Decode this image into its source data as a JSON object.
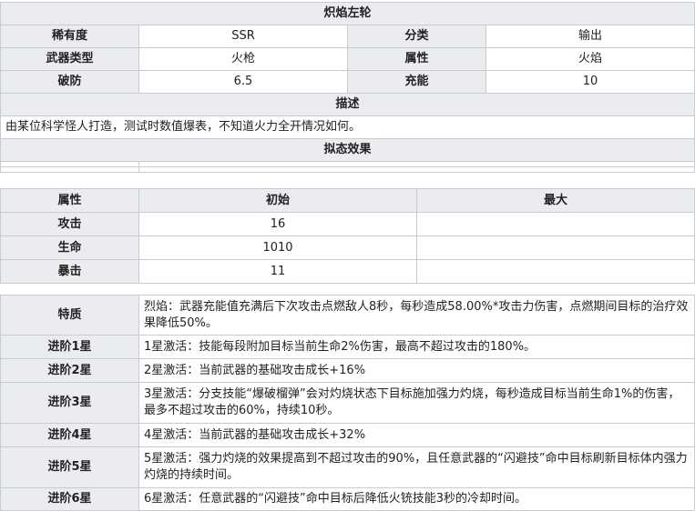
{
  "weapon": {
    "name": "炽焰左轮",
    "rarity_label": "稀有度",
    "rarity_value": "SSR",
    "category_label": "分类",
    "category_value": "输出",
    "type_label": "武器类型",
    "type_value": "火枪",
    "element_label": "属性",
    "element_value": "火焰",
    "armor_break_label": "破防",
    "armor_break_value": "6.5",
    "charge_label": "充能",
    "charge_value": "10",
    "desc_header": "描述",
    "desc_text": "由某位科学怪人打造，测试时数值爆表，不知道火力全开情况如何。",
    "effect_header": "拟态效果"
  },
  "stats": {
    "headers": [
      "属性",
      "初始",
      "最大"
    ],
    "rows": [
      {
        "name": "攻击",
        "initial": "16",
        "max": ""
      },
      {
        "name": "生命",
        "initial": "1010",
        "max": ""
      },
      {
        "name": "暴击",
        "initial": "11",
        "max": ""
      }
    ]
  },
  "traits": [
    {
      "label": "特质",
      "text": "烈焰：武器充能值充满后下次攻击点燃敌人8秒，每秒造成58.00%*攻击力伤害，点燃期间目标的治疗效果降低50%。"
    },
    {
      "label": "进阶1星",
      "text": "1星激活：技能每段附加目标当前生命2%伤害，最高不超过攻击的180%。"
    },
    {
      "label": "进阶2星",
      "text": "2星激活：当前武器的基础攻击成长+16%"
    },
    {
      "label": "进阶3星",
      "text": "3星激活：分支技能“爆破榴弹”会对灼烧状态下目标施加强力灼烧，每秒造成目标当前生命1%的伤害，最多不超过攻击的60%，持续10秒。"
    },
    {
      "label": "进阶4星",
      "text": "4星激活：当前武器的基础攻击成长+32%"
    },
    {
      "label": "进阶5星",
      "text": "5星激活：强力灼烧的效果提高到不超过攻击的90%，且任意武器的“闪避技”命中目标刷新目标体内强力灼烧的持续时间。"
    },
    {
      "label": "进阶6星",
      "text": "6星激活：任意武器的“闪避技”命中目标后降低火铳技能3秒的冷却时间。"
    }
  ]
}
